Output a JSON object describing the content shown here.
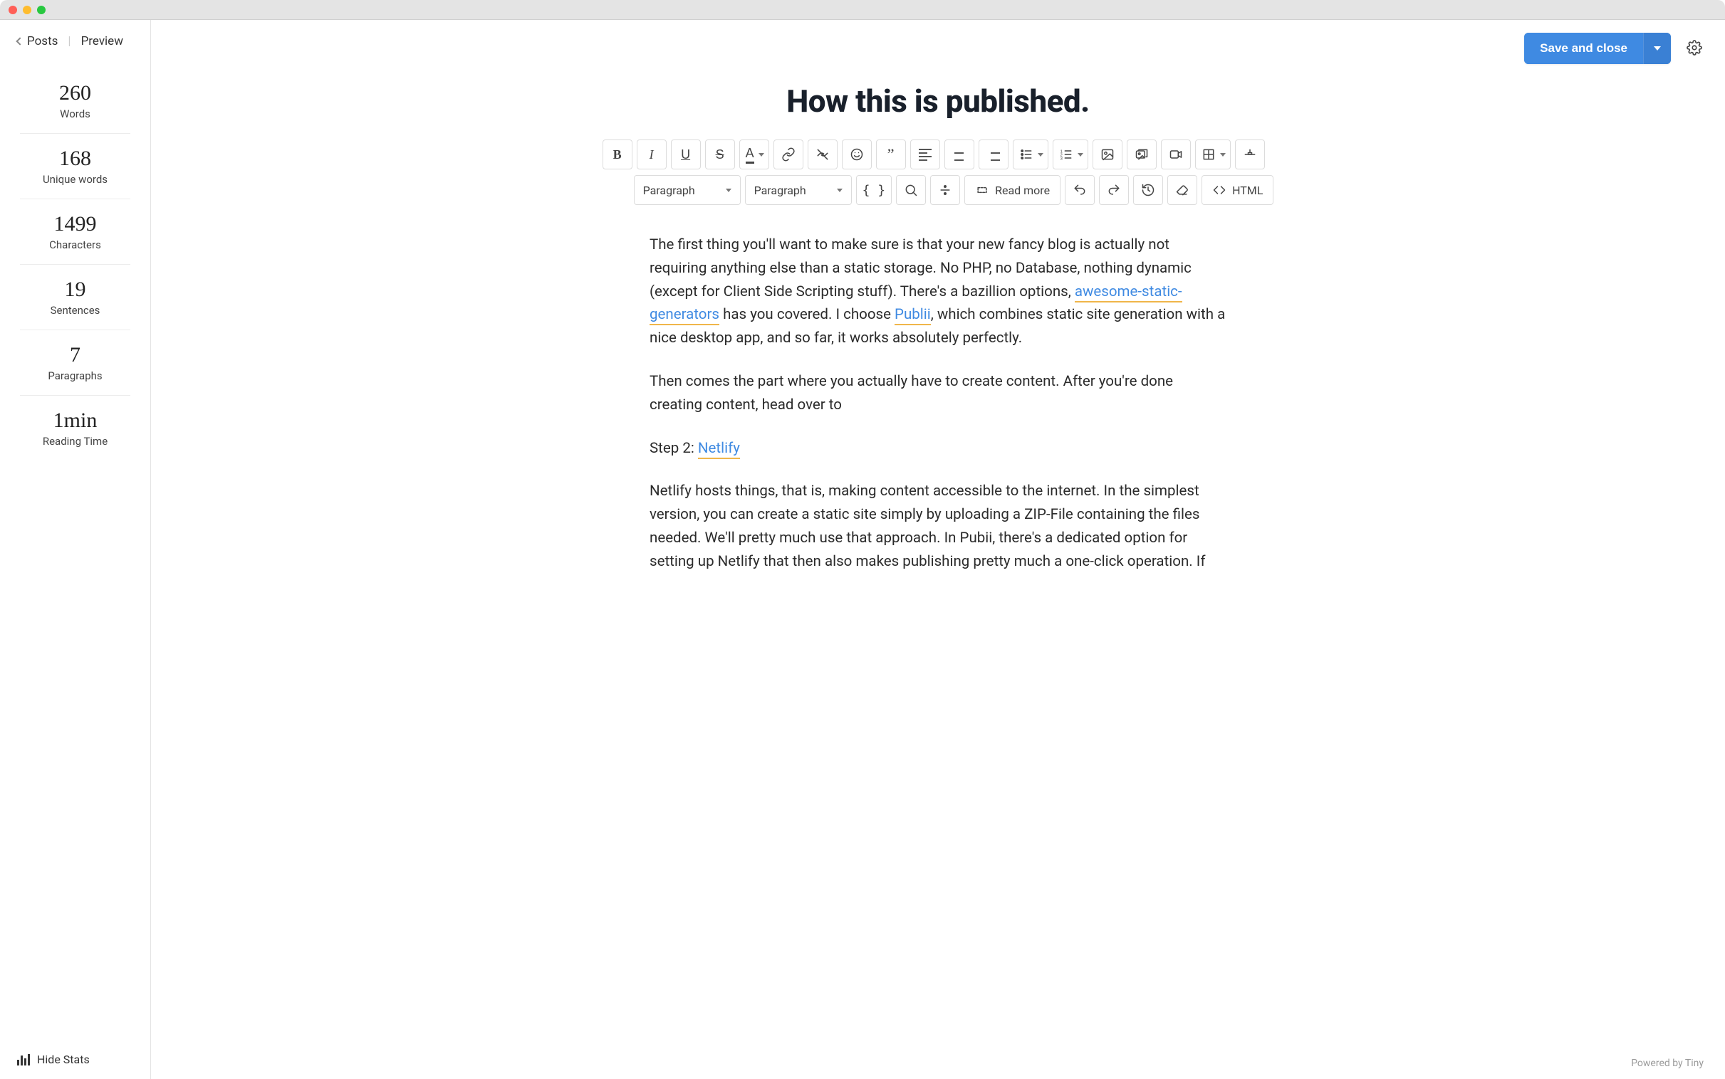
{
  "nav": {
    "posts": "Posts",
    "preview": "Preview"
  },
  "stats": {
    "words": {
      "value": "260",
      "label": "Words"
    },
    "unique": {
      "value": "168",
      "label": "Unique words"
    },
    "chars": {
      "value": "1499",
      "label": "Characters"
    },
    "sentences": {
      "value": "19",
      "label": "Sentences"
    },
    "paragraphs": {
      "value": "7",
      "label": "Paragraphs"
    },
    "reading": {
      "value": "1min",
      "label": "Reading Time"
    }
  },
  "side_bottom": {
    "hide_stats": "Hide Stats"
  },
  "header": {
    "save_close": "Save and close"
  },
  "post": {
    "title": "How this is published."
  },
  "toolbar": {
    "format1": "Paragraph",
    "format2": "Paragraph",
    "readmore": "Read more",
    "html": "HTML"
  },
  "content": {
    "p1a": "The first thing you'll want to make sure is that your new fancy blog is actually not requiring anything else than a static storage. No PHP, no Database, nothing dynamic (except for Client Side Scripting stuff). There's a bazillion options, ",
    "link1": "awesome-static-generators",
    "p1b": " has you covered. I choose ",
    "link2": "Publii",
    "p1c": ", which combines static site generation with a nice desktop app, and so far, it works absolutely perfectly.",
    "p2": "Then comes the part where you actually have to create content. After you're done creating content, head over to",
    "p3a": "Step 2: ",
    "link3": "Netlify",
    "p4": "Netlify hosts things, that is, making content accessible to the internet. In the simplest version, you can create a static site simply by uploading a ZIP-File containing the files needed. We'll pretty much use that approach. In Pubii, there's a dedicated option for setting up Netlify that then also makes publishing pretty much a one-click operation. If"
  },
  "footer": {
    "powered": "Powered by Tiny"
  }
}
